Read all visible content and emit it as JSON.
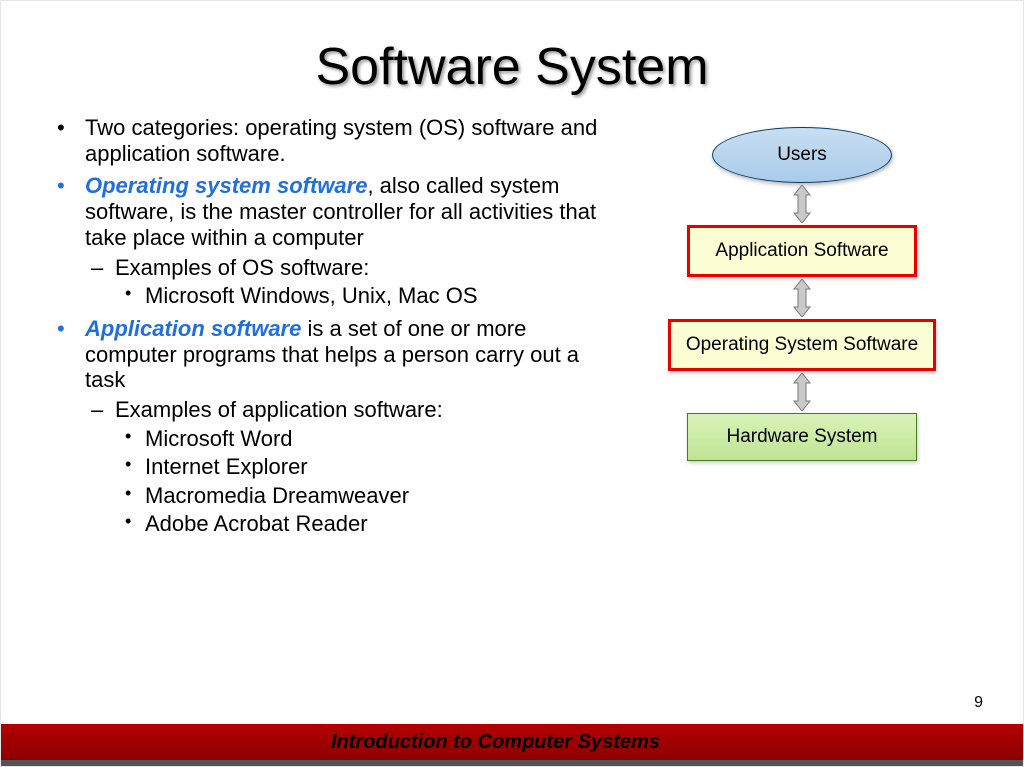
{
  "title": "Software System",
  "bullets": {
    "b1": "Two categories:  operating system (OS) software and application software.",
    "b2_term": "Operating system software",
    "b2_rest": ", also called system software, is the master controller for all activities that take place within a computer",
    "b2_sub": "Examples of OS software:",
    "b2_sub_item": "Microsoft Windows, Unix, Mac OS",
    "b3_term": "Application software",
    "b3_rest": " is a set of one or more computer programs that helps a person carry out a task",
    "b3_sub": "Examples of application software:",
    "b3_items": {
      "i1": "Microsoft Word",
      "i2": "Internet Explorer",
      "i3": "Macromedia Dreamweaver",
      "i4": "Adobe Acrobat Reader"
    }
  },
  "diagram": {
    "users": "Users",
    "app": "Application Software",
    "os": "Operating System Software",
    "hw": "Hardware System"
  },
  "footer": "Introduction to Computer Systems",
  "page": "9"
}
